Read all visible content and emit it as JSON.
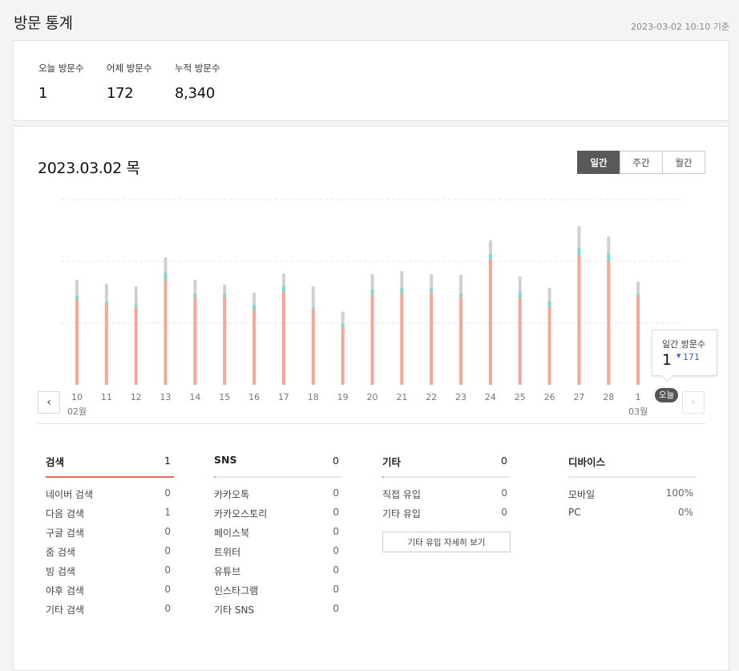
{
  "header": {
    "title": "방문 통계",
    "timestamp": "2023-03-02 10:10 기준"
  },
  "summary": {
    "today_label": "오늘 방문수",
    "today_value": "1",
    "yesterday_label": "어제 방문수",
    "yesterday_value": "172",
    "total_label": "누적 방문수",
    "total_value": "8,340"
  },
  "main": {
    "date_title": "2023.03.02 목",
    "period_tabs": [
      "일간",
      "주간",
      "월간"
    ],
    "active_period": "일간"
  },
  "chart_data": {
    "type": "bar",
    "stacked": true,
    "categories": [
      "10",
      "11",
      "12",
      "13",
      "14",
      "15",
      "16",
      "17",
      "18",
      "19",
      "20",
      "21",
      "22",
      "23",
      "24",
      "25",
      "26",
      "27",
      "28",
      "1"
    ],
    "month_labels": [
      {
        "index": 0,
        "label": "02월"
      },
      {
        "index": 19,
        "label": "03월"
      }
    ],
    "series": [
      {
        "name": "검색",
        "color": "#f7a596",
        "values": [
          138,
          131,
          126,
          170,
          143,
          143,
          122,
          151,
          123,
          93,
          147,
          148,
          151,
          143,
          204,
          141,
          127,
          210,
          201,
          144
        ]
      },
      {
        "color": "#7ad8cf",
        "values": [
          6,
          5,
          4,
          12,
          6,
          5,
          8,
          10,
          3,
          6,
          8,
          10,
          6,
          6,
          9,
          10,
          9,
          13,
          12,
          4
        ]
      },
      {
        "color": "#cfd0d2",
        "values": [
          27,
          28,
          30,
          25,
          22,
          15,
          20,
          20,
          34,
          20,
          25,
          27,
          23,
          30,
          22,
          25,
          22,
          35,
          28,
          20
        ]
      }
    ],
    "ylim": [
      0,
      300
    ],
    "grid": true,
    "tooltip": {
      "label": "일간 방문수",
      "value": "1",
      "previous": "171"
    },
    "today_badge": "오늘"
  },
  "sources": {
    "search": {
      "title": "검색",
      "count": "1",
      "color": "#e26a5a",
      "items": [
        {
          "label": "네이버 검색",
          "value": "0"
        },
        {
          "label": "다음 검색",
          "value": "1"
        },
        {
          "label": "구글 검색",
          "value": "0"
        },
        {
          "label": "줌 검색",
          "value": "0"
        },
        {
          "label": "빙 검색",
          "value": "0"
        },
        {
          "label": "야후 검색",
          "value": "0"
        },
        {
          "label": "기타 검색",
          "value": "0"
        }
      ]
    },
    "sns": {
      "title": "SNS",
      "count": "0",
      "color": "#6fd2c6",
      "items": [
        {
          "label": "카카오톡",
          "value": "0"
        },
        {
          "label": "카카오스토리",
          "value": "0"
        },
        {
          "label": "페이스북",
          "value": "0"
        },
        {
          "label": "트위터",
          "value": "0"
        },
        {
          "label": "유튜브",
          "value": "0"
        },
        {
          "label": "인스타그램",
          "value": "0"
        },
        {
          "label": "기타 SNS",
          "value": "0"
        }
      ]
    },
    "etc": {
      "title": "기타",
      "count": "0",
      "color": "#6fd2c6",
      "items": [
        {
          "label": "직접 유입",
          "value": "0"
        },
        {
          "label": "기타 유입",
          "value": "0"
        }
      ],
      "detail_button": "기타 유입 자세히 보기"
    },
    "device": {
      "title": "디바이스",
      "items": [
        {
          "label": "모바일",
          "value": "100%"
        },
        {
          "label": "PC",
          "value": "0%"
        }
      ]
    }
  }
}
